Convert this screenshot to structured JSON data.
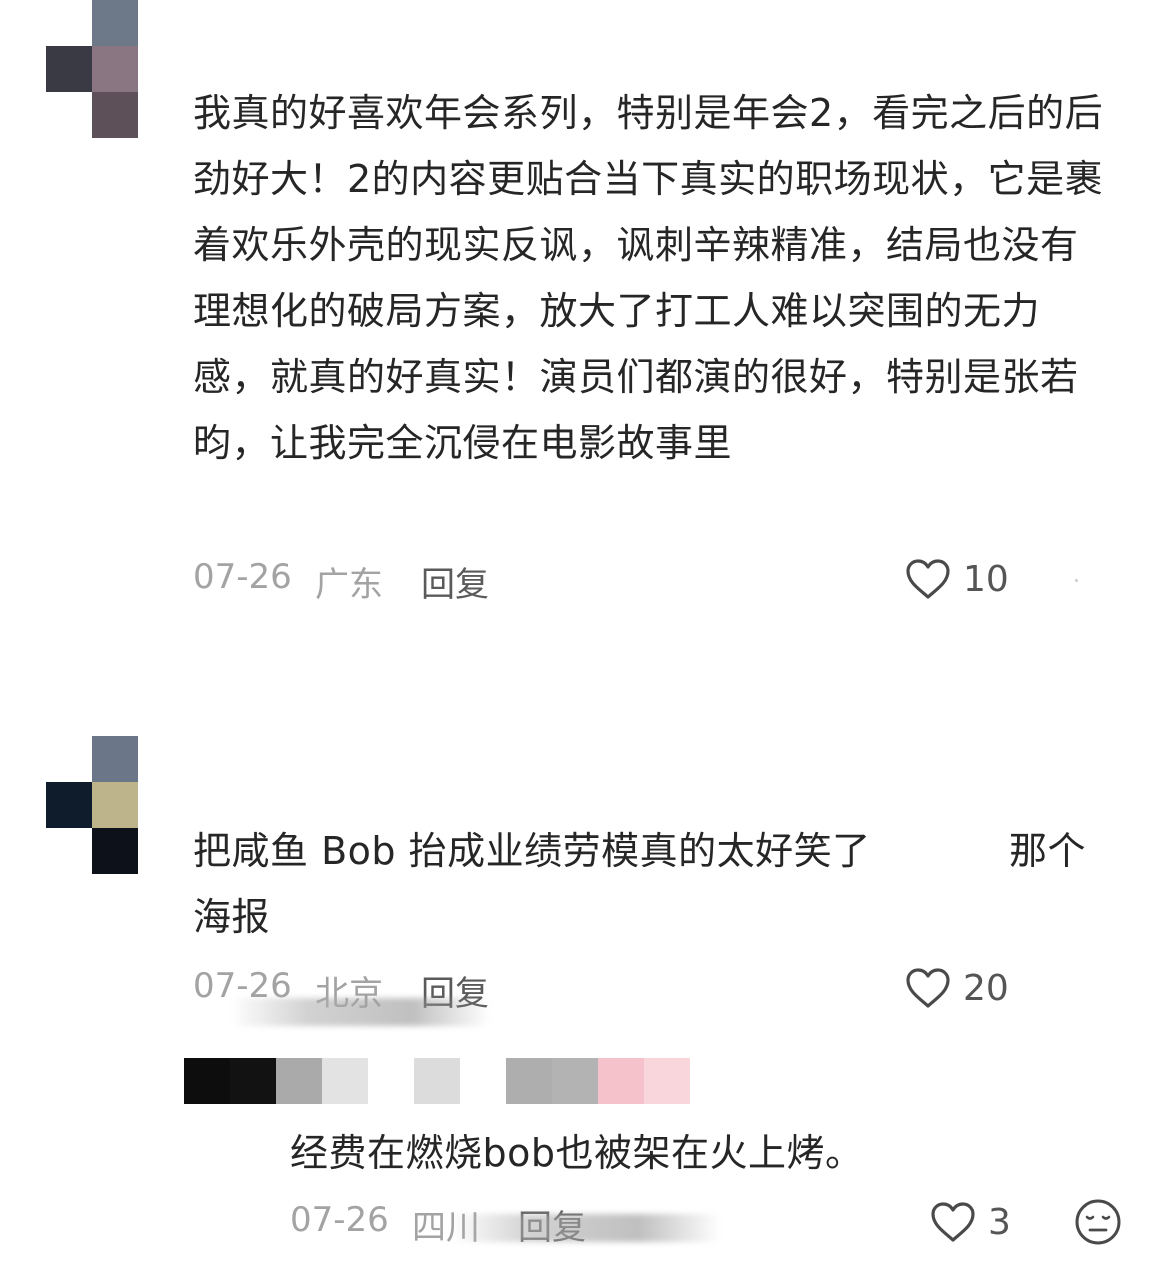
{
  "comments": [
    {
      "text": "我真的好喜欢年会系列，特别是年会2，看完之后的后劲好大！2的内容更贴合当下真实的职场现状，它是裹着欢乐外壳的现实反讽，讽刺辛辣精准，结局也没有理想化的破局方案，放大了打工人难以突围的无力感，就真的好真实！演员们都演的很好，特别是张若昀，让我完全沉侵在电影故事里",
      "date": "07-26",
      "location": "广东",
      "reply_label": "回复",
      "likes": "10"
    },
    {
      "text": "把咸鱼 Bob 抬成业绩劳模真的太好笑了           那个海报",
      "date": "07-26",
      "location": "北京",
      "reply_label": "回复",
      "likes": "20",
      "replies": [
        {
          "text": "经费在燃烧bob也被架在火上烤。",
          "date": "07-26",
          "location": "四川",
          "reply_label": "回复",
          "likes": "3"
        }
      ]
    }
  ],
  "colors": {
    "text": "#262626",
    "meta": "#a3a3a3",
    "action": "#5a5a5a",
    "icon": "#4a4a4a"
  },
  "icons": {
    "like": "heart-outline-icon",
    "emoji": "emoji-face-icon"
  }
}
